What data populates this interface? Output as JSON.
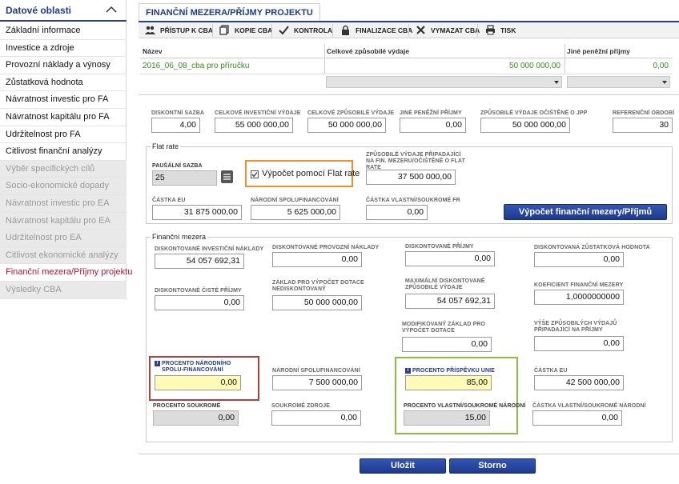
{
  "sidebar": {
    "title": "Datové oblasti",
    "items": [
      {
        "label": "Základní informace",
        "state": "normal"
      },
      {
        "label": "Investice a zdroje",
        "state": "normal"
      },
      {
        "label": "Provozní náklady a výnosy",
        "state": "normal"
      },
      {
        "label": "Zůstatková hodnota",
        "state": "normal"
      },
      {
        "label": "Návratnost investic pro FA",
        "state": "normal"
      },
      {
        "label": "Návratnost kapitálu pro FA",
        "state": "normal"
      },
      {
        "label": "Udržitelnost pro FA",
        "state": "normal"
      },
      {
        "label": "Citlivost finanční analýzy",
        "state": "normal"
      },
      {
        "label": "Výběr specifických cílů",
        "state": "disabled"
      },
      {
        "label": "Socio-ekonomické dopady",
        "state": "disabled"
      },
      {
        "label": "Návratnost investic pro EA",
        "state": "disabled"
      },
      {
        "label": "Návratnost kapitálu pro EA",
        "state": "disabled"
      },
      {
        "label": "Udržitelnost pro EA",
        "state": "disabled"
      },
      {
        "label": "Citlivost ekonomické analýzy",
        "state": "disabled"
      },
      {
        "label": "Finanční mezera/Příjmy projektu",
        "state": "active"
      },
      {
        "label": "Výsledky CBA",
        "state": "disabled"
      }
    ]
  },
  "tab": {
    "label": "FINANČNÍ MEZERA/PŘÍJMY PROJEKTU"
  },
  "toolbar": {
    "items": [
      {
        "label": "PŘÍSTUP K CBA",
        "icon": "users-icon"
      },
      {
        "label": "KOPIE CBA",
        "icon": "copy-icon"
      },
      {
        "label": "KONTROLA",
        "icon": "check-icon"
      },
      {
        "label": "FINALIZACE CBA",
        "icon": "lock-icon"
      },
      {
        "label": "VYMAZAT CBA",
        "icon": "close-icon"
      },
      {
        "label": "TISK",
        "icon": "print-icon"
      }
    ]
  },
  "grid": {
    "headers": [
      "Název",
      "Celkové způsobilé výdaje",
      "Jiné peněžní příjmy"
    ],
    "row": {
      "name": "2016_06_08_cba pro příručku",
      "total": "50 000 000,00",
      "other": "0,00"
    }
  },
  "top_fields": {
    "diskont_sazba": {
      "label": "DISKONTNÍ SAZBA",
      "value": "4,00"
    },
    "celk_inv": {
      "label": "CELKOVÉ INVESTIČNÍ VÝDAJE",
      "value": "55 000 000,00"
    },
    "celk_zp": {
      "label": "CELKOVÉ ZPŮSOBILÉ VÝDAJE",
      "value": "50 000 000,00"
    },
    "jine_prijmy": {
      "label": "JINÉ PENĚŽNÍ PŘÍJMY",
      "value": "0,00"
    },
    "zp_ocistene": {
      "label": "ZPŮSOBILÉ VÝDAJE OČIŠTĚNÉ O JPP",
      "value": "50 000 000,00"
    },
    "ref_obdobi": {
      "label": "REFERENČNÍ OBDOBÍ",
      "value": "30"
    }
  },
  "flat_rate": {
    "legend": "Flat rate",
    "pausalni": {
      "label": "PAUŠÁLNÍ SAZBA",
      "value": "25"
    },
    "checkbox_label": "Výpočet pomocí Flat rate",
    "zp_pripadajici": {
      "label": "ZPŮSOBILÉ VÝDAJE PŘIPADAJÍCÍ NA FIN. MEZERU/OČIŠTĚNÉ O FLAT RATE",
      "value": "37 500 000,00"
    },
    "castka_eu": {
      "label": "ČÁSTKA EU",
      "value": "31 875 000,00"
    },
    "narodni": {
      "label": "NÁRODNÍ SPOLUFINANCOVÁNÍ",
      "value": "5 625 000,00"
    },
    "vlastni": {
      "label": "ČÁSTKA VLASTNÍ/SOUKROMÉ FR",
      "value": "0,00"
    },
    "calc_button": "Výpočet finanční mezery/Příjmů"
  },
  "fin_mezera": {
    "legend": "Finanční mezera",
    "disk_inv": {
      "label": "DISKONTOVANÉ INVESTIČNÍ NÁKLADY",
      "value": "54 057 692,31"
    },
    "disk_prov": {
      "label": "DISKONTOVANÉ PROVOZNÍ NÁKLADY",
      "value": "0,00"
    },
    "disk_prijmy": {
      "label": "DISKONTOVANÉ PŘÍJMY",
      "value": "0,00"
    },
    "disk_zust": {
      "label": "DISKONTOVANÁ ZŮSTATKOVÁ HODNOTA",
      "value": "0,00"
    },
    "disk_ciste": {
      "label": "DISKONTOVANÉ ČISTÉ PŘÍJMY",
      "value": "0,00"
    },
    "zaklad_nedisk": {
      "label": "ZÁKLAD PRO VÝPOČET DOTACE NEDISKONTOVANÝ",
      "value": "50 000 000,00"
    },
    "max_disk": {
      "label": "MAXIMÁLNÍ DISKONTOVANÉ ZPŮSOBILÉ VÝDAJE",
      "value": "54 057 692,31"
    },
    "koef": {
      "label": "KOEFICIENT FINANČNÍ MEZERY",
      "value": "1,0000000000"
    },
    "modif_zaklad": {
      "label": "MODIFIKOVANÝ ZÁKLAD PRO VÝPOČET DOTACE",
      "value": "0,00"
    },
    "vyse_zp": {
      "label": "VÝŠE ZPŮSOBILÝCH VÝDAJŮ PŘIPADAJÍCÍ NA PŘÍJMY",
      "value": "0,00"
    },
    "proc_narodni": {
      "label": "PROCENTO NÁRODNÍHO SPOLU-FINANCOVÁNÍ",
      "value": "0,00"
    },
    "narodni_spol": {
      "label": "NÁRODNÍ SPOLUFINANCOVÁNÍ",
      "value": "7 500 000,00"
    },
    "proc_unie": {
      "label": "PROCENTO PŘÍSPĚVKU UNIE",
      "value": "85,00"
    },
    "castka_eu": {
      "label": "ČÁSTKA EU",
      "value": "42 500 000,00"
    },
    "proc_soukrome": {
      "label": "PROCENTO SOUKROMÉ",
      "value": "0,00"
    },
    "soukrome_zdroje": {
      "label": "SOUKROMÉ ZDROJE",
      "value": "0,00"
    },
    "proc_vlastni": {
      "label": "PROCENTO VLASTNÍ/SOUKROMÉ NÁRODNÍ",
      "value": "15,00"
    },
    "castka_vlastni": {
      "label": "ČÁSTKA VLASTNÍ/SOUKROMÉ NÁRODNÍ",
      "value": "0,00"
    }
  },
  "actions": {
    "save": "Uložit",
    "cancel": "Storno"
  },
  "colors": {
    "accent": "#1f3a8a",
    "active": "#c8102e",
    "green_text": "#3a8a1e",
    "orange_box": "#f0902d",
    "red_box": "#b2413e",
    "green_box": "#8dbd3f",
    "highlight": "#fdfbb6"
  }
}
